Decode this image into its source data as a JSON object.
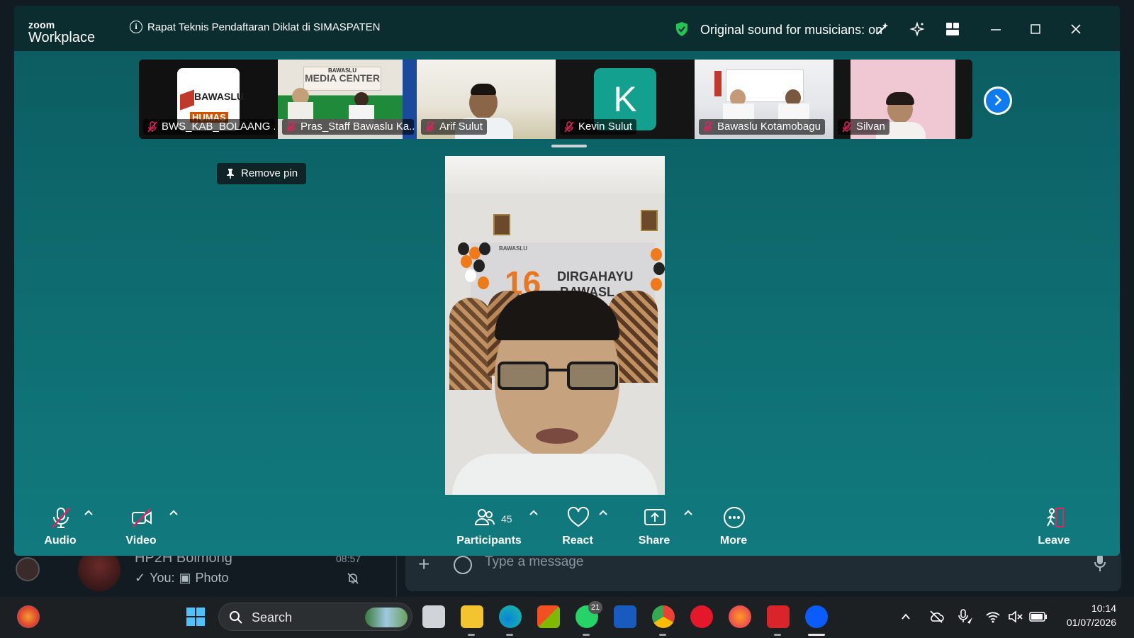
{
  "app": {
    "logo_top": "zoom",
    "logo_bottom": "Workplace"
  },
  "titlebar": {
    "meeting_title": "Rapat Teknis Pendaftaran Diklat di SIMASPATEN",
    "original_sound": "Original sound for musicians: on"
  },
  "thumbnails": [
    {
      "name": "BWS_KAB_BOLAANG ..."
    },
    {
      "name": "Pras_Staff Bawaslu Ka..."
    },
    {
      "name": "Arif Sulut"
    },
    {
      "name": "Kevin Sulut",
      "avatar_letter": "K"
    },
    {
      "name": "Bawaslu Kotamobagu"
    },
    {
      "name": "Silvan"
    }
  ],
  "thumb_texts": {
    "bawaslu_logo": "BAWASLU",
    "humas": "HUMAS",
    "media_center": "MEDIA CENTER",
    "media_center_top": "BAWASLU"
  },
  "main_video": {
    "banner_text": "DIRGAHAYU",
    "banner_text2": "BAWASL",
    "banner_logo": "BAWASLU"
  },
  "remove_pin": "Remove pin",
  "toolbar": {
    "audio": "Audio",
    "video": "Video",
    "participants": "Participants",
    "participants_count": "45",
    "react": "React",
    "share": "Share",
    "more": "More",
    "leave": "Leave"
  },
  "background_chat": {
    "name": "HP2H Bolmong",
    "time": "08:57",
    "preview_you": "You:",
    "preview_photo": "Photo",
    "input_placeholder": "Type a message"
  },
  "taskbar": {
    "search": "Search",
    "whatsapp_badge": "21",
    "time": "10:14",
    "date": "01/07/2026"
  },
  "colors": {
    "zoom_bg": "#0e6c70",
    "titlebar": "#0c2d2f",
    "accent_blue": "#0e7cf0",
    "muted_red": "#e0245e"
  }
}
